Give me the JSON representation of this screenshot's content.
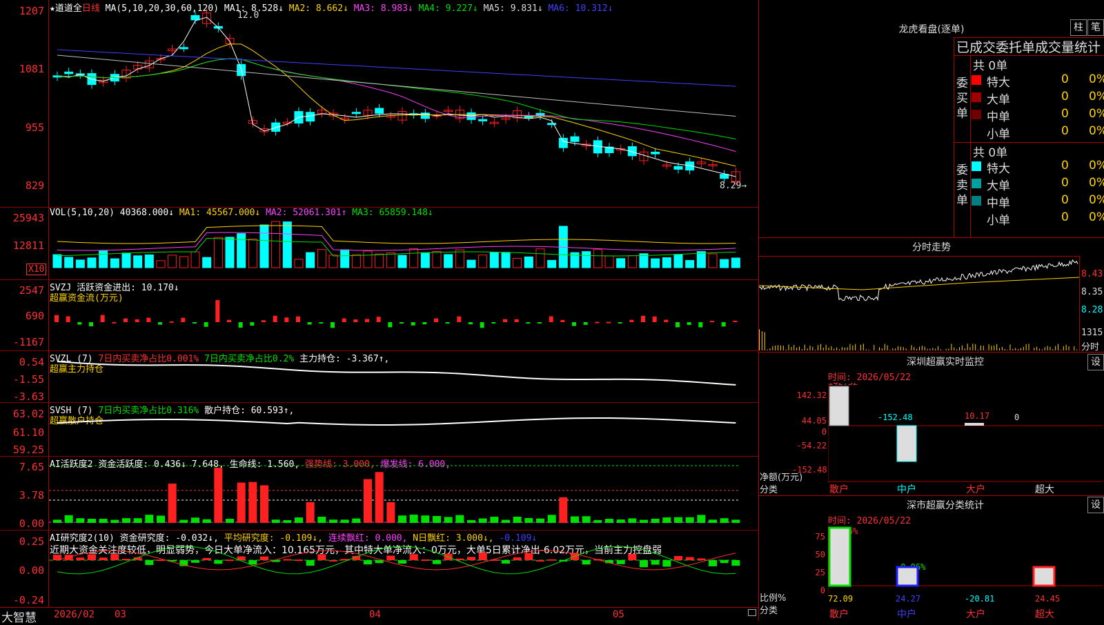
{
  "colors": {
    "up": "#ff2020",
    "down": "#00ffff",
    "ma1": "#ffffff",
    "ma2": "#ffd400",
    "ma3": "#ff40ff",
    "ma4": "#00e000",
    "ma5": "#c0c0c0",
    "ma6": "#4040ff"
  },
  "header": {
    "stock_name": "★道道全",
    "period": "日线",
    "ma_label": "MA(5,10,20,30,60,120)",
    "ma1": "MA1: 8.528↓",
    "ma2": "MA2: 8.662↓",
    "ma3": "MA3: 8.983↓",
    "ma4": "MA4: 9.227↓",
    "ma5": "MA5: 9.831↓",
    "ma6": "MA6: 10.312↓",
    "high_mark": "12.0",
    "low_mark": "8.29→"
  },
  "price_axis": [
    "1207",
    "1081",
    "955",
    "829"
  ],
  "vol": {
    "label": "VOL(5,10,20)",
    "value": "40368.000↓",
    "ma1": "MA1: 45567.000↓",
    "ma2": "MA2: 52061.301↑",
    "ma3": "MA3: 65859.148↓",
    "axis": [
      "25943",
      "12811"
    ],
    "unit": "X10"
  },
  "svzj": {
    "title": "SVZJ  活跃资金进出: 10.170↓",
    "sub": "超赢资金流(万元)",
    "axis": [
      "2547",
      "690",
      "-1167"
    ]
  },
  "svzl": {
    "title_a": "SVZL (7)",
    "title_b": "7日内买卖净占比0.001%",
    "title_c": "7日内买卖净占比0.2%",
    "title_d": "主力持仓: -3.367↑,",
    "sub": "超赢主力持仓",
    "axis": [
      "0.54",
      "-1.55",
      "-3.63"
    ]
  },
  "svsh": {
    "title_a": "SVSH (7)",
    "title_b": "7日内买卖净占比0.316%",
    "title_c": "散户持仓: 60.593↑,",
    "sub": "超赢散户持仓",
    "axis": [
      "63.02",
      "61.10",
      "59.25"
    ]
  },
  "ai1": {
    "title_a": "AI活跃度2",
    "title_b": "资金活跃度: 0.436↓",
    "title_c": "7.648,",
    "title_d": "生命线: 1.560,",
    "title_e": "强势线: 3.000,",
    "title_f": "爆发线: 6.000,",
    "axis": [
      "7.65",
      "3.78",
      "0.00"
    ]
  },
  "ai2": {
    "title_a": "AI研究度2(10)",
    "title_b": "资金研究度: -0.032↓,",
    "title_c": "平均研究度: -0.109↓,",
    "title_d": "连续飘红: 0.000,",
    "title_e": "N日飘红: 3.000↓,",
    "title_f": "-0.109↓",
    "comment": "近期大资金关注度较低，明显弱势，今日大单净流入：10.165万元，其中特大单净流入：0万元，大单5日累计净出-6.02万元，当前主力控盘弱",
    "axis": [
      "0.25",
      "0.00",
      "-0.24"
    ]
  },
  "bottom": {
    "brand": "大智慧",
    "date": "2026/02",
    "m03": "03",
    "m04": "04",
    "m05": "05"
  },
  "right": {
    "lhb_title": "龙虎看盘(逐单)",
    "btn_zhu": "柱",
    "btn_bi": "笔",
    "stats_title": "已成交委托单成交量统计",
    "buy_label": "委买单",
    "sell_label": "委卖单",
    "buy_total": "共 0单",
    "sell_total": "共 0单",
    "buy_rows": [
      {
        "name": "特大",
        "v": "0",
        "p": "0%"
      },
      {
        "name": "大单",
        "v": "0",
        "p": "0%"
      },
      {
        "name": "中单",
        "v": "0",
        "p": "0%"
      },
      {
        "name": "小单",
        "v": "0",
        "p": "0%"
      }
    ],
    "sell_rows": [
      {
        "name": "特大",
        "v": "0",
        "p": "0%"
      },
      {
        "name": "大单",
        "v": "0",
        "p": "0%"
      },
      {
        "name": "中单",
        "v": "0",
        "p": "0%"
      },
      {
        "name": "小单",
        "v": "0",
        "p": "0%"
      }
    ],
    "ts_title": "分时走势",
    "ts_axis": [
      "8.43",
      "8.35",
      "8.28"
    ],
    "ts_vol": "1315",
    "ts_unit": "分时",
    "sz_title": "深圳超赢实时监控",
    "sz_btn": "设",
    "sz_time": "时间: 2026/05/22",
    "sz_axis": [
      "142.32",
      "44.05",
      "0",
      "-54.22",
      "-152.48"
    ],
    "sz_vals": {
      "san": "142.32",
      "zhong": "-152.48",
      "da": "10.17",
      "chao": "0"
    },
    "sz_ylabel": "净额(万元)",
    "sz_xlabel": "分类",
    "cats": {
      "san": "散户",
      "zhong": "中户",
      "da": "大户",
      "chao": "超大"
    },
    "ss_title": "深市超赢分类统计",
    "ss_btn": "设",
    "ss_time": "时间: 2026/05/22",
    "ss_axis": [
      "75",
      "50",
      "25",
      "0"
    ],
    "ss_top": {
      "a": "+0.06%",
      "b": "-0.06%"
    },
    "ss_vals": {
      "san": "72.09",
      "zhong": "24.27",
      "da": "-20.81",
      "chao": "24.45"
    },
    "ss_ylabel": "比例%",
    "ss_xlabel": "分类"
  }
}
